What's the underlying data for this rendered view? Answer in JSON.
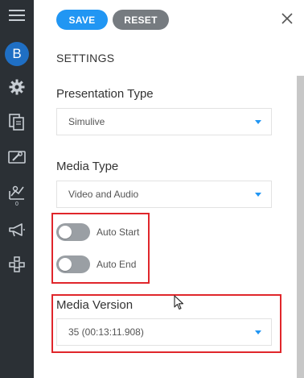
{
  "sidebar": {
    "avatar_letter": "B",
    "badge_count": "0",
    "icons": [
      "menu-icon",
      "gear-icon",
      "documents-icon",
      "tools-icon",
      "analytics-icon",
      "megaphone-icon",
      "network-icon"
    ]
  },
  "toolbar": {
    "save_label": "SAVE",
    "reset_label": "RESET"
  },
  "settings": {
    "title": "SETTINGS",
    "presentation_type": {
      "label": "Presentation Type",
      "value": "Simulive"
    },
    "media_type": {
      "label": "Media Type",
      "value": "Video and Audio"
    },
    "auto_start": {
      "label": "Auto Start",
      "on": false
    },
    "auto_end": {
      "label": "Auto End",
      "on": false
    },
    "media_version": {
      "label": "Media Version",
      "value": "35 (00:13:11.908)"
    }
  },
  "colors": {
    "sidebar_bg": "#2b3035",
    "accent": "#2196f3",
    "reset_bg": "#767b80",
    "highlight": "#e0262b",
    "avatar_bg": "#1f6fc4"
  }
}
